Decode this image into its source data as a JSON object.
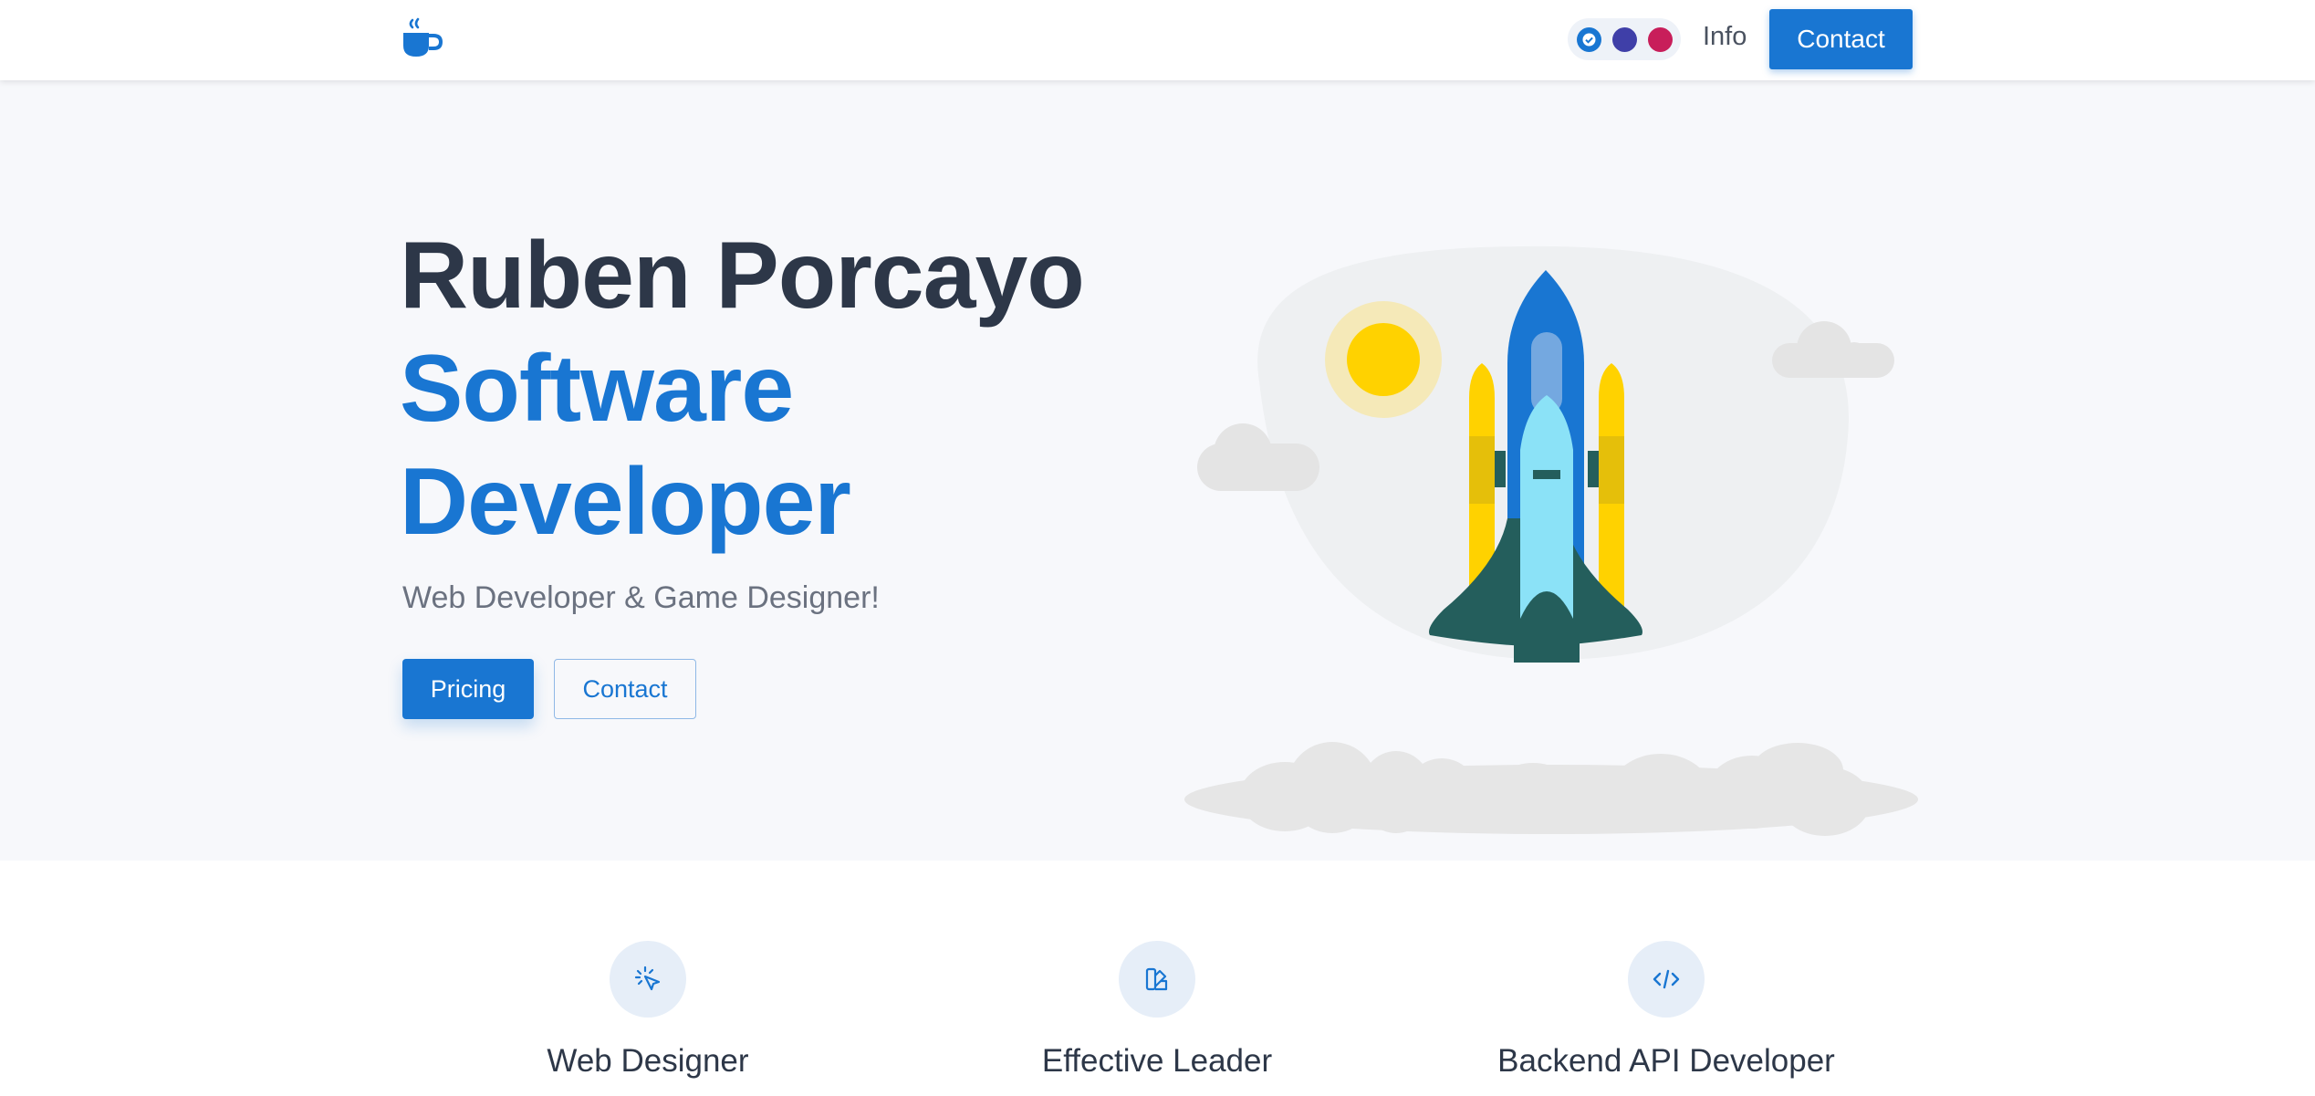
{
  "header": {
    "logo_icon": "coffee-cup-icon",
    "theme_colors": [
      "#1976d2",
      "#3f3fa8",
      "#c81e5a"
    ],
    "nav_info": "Info",
    "nav_contact": "Contact"
  },
  "hero": {
    "name": "Ruben Porcayo",
    "role_line1": "Software",
    "role_line2": "Developer",
    "subtitle": "Web Developer & Game Designer!",
    "primary_button": "Pricing",
    "secondary_button": "Contact",
    "illustration_icon": "rocket-launch-illustration"
  },
  "features": [
    {
      "icon": "cursor-click-icon",
      "title": "Web Designer"
    },
    {
      "icon": "swatch-book-icon",
      "title": "Effective Leader"
    },
    {
      "icon": "code-icon",
      "title": "Backend API Developer"
    }
  ],
  "colors": {
    "primary": "#1976d2",
    "heading": "#2d3748",
    "hero_bg": "#f7f8fb"
  }
}
